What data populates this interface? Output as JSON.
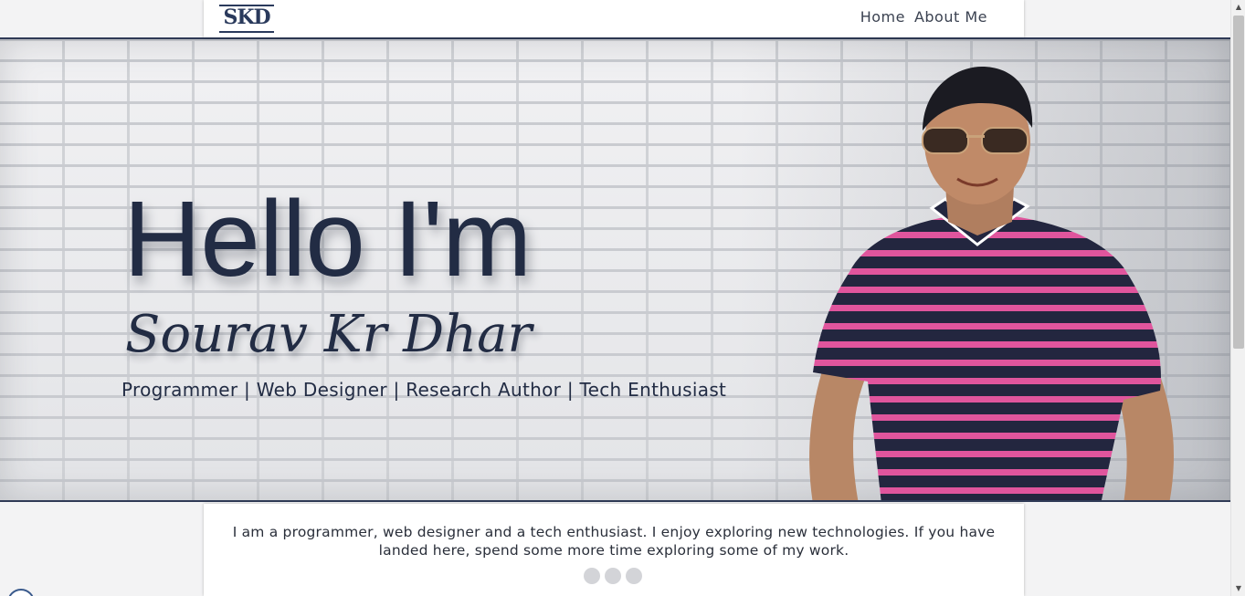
{
  "header": {
    "logo_text": "SKD",
    "nav": [
      {
        "label": "Home"
      },
      {
        "label": "About Me"
      }
    ]
  },
  "hero": {
    "greeting": "Hello I'm",
    "name": "Sourav Kr Dhar",
    "roles": "Programmer | Web Designer | Research Author | Tech Enthusiast"
  },
  "intro": {
    "text": "I am a programmer, web designer and a tech enthusiast. I enjoy exploring new technologies. If you have landed here, spend some more time exploring some of my work."
  },
  "colors": {
    "accent": "#222c44",
    "shirt_navy": "#23263f",
    "shirt_pink": "#e0559d",
    "page_bg": "#f3f3f4"
  },
  "slider": {
    "dot_count": 3
  },
  "icons": [
    "logo-icon",
    "scroll-up-icon",
    "scroll-down-icon"
  ]
}
